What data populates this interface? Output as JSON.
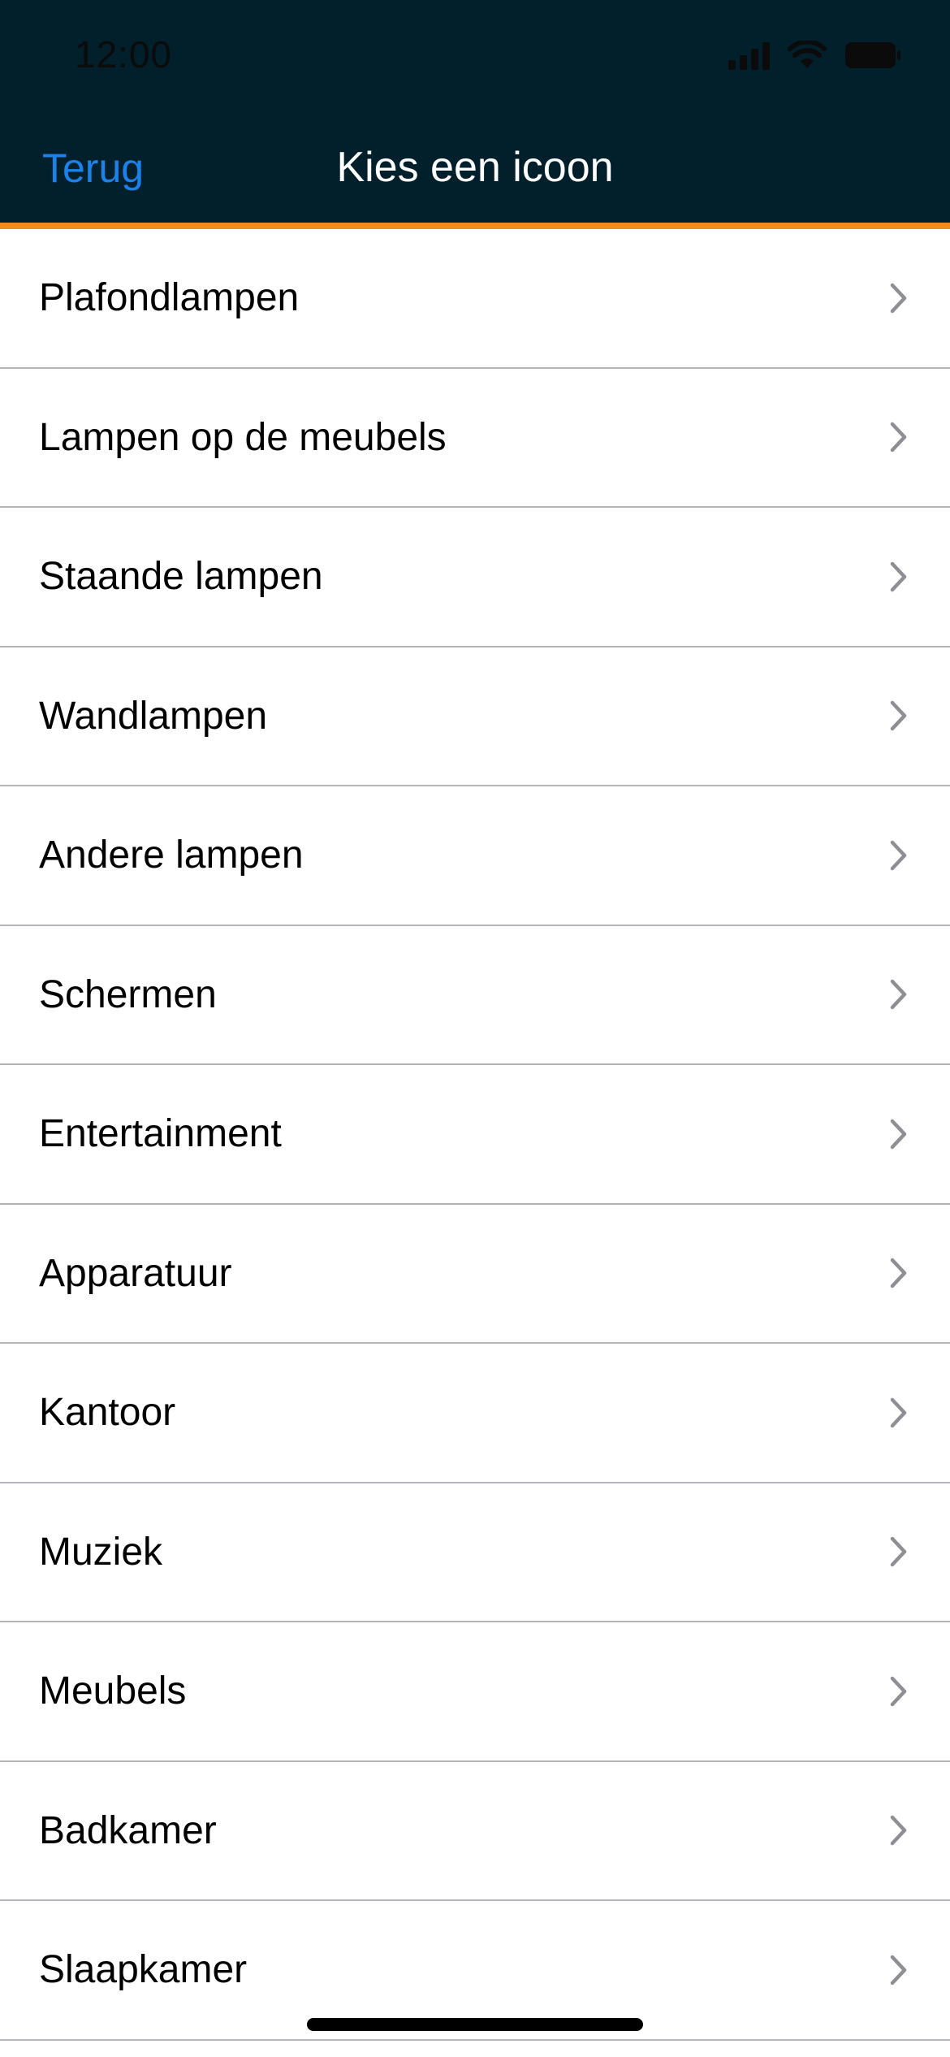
{
  "status_bar": {
    "time": "12:00",
    "icons": [
      "signal-icon",
      "wifi-icon",
      "battery-icon"
    ]
  },
  "nav": {
    "back_label": "Terug",
    "title": "Kies een icoon"
  },
  "colors": {
    "header_background": "#01202b",
    "accent_line": "#f28c1e",
    "back_link": "#1a82e8",
    "chevron": "#8e8e93",
    "separator": "#b4b4b8"
  },
  "list": {
    "items": [
      {
        "label": "Plafondlampen"
      },
      {
        "label": "Lampen op de meubels"
      },
      {
        "label": "Staande lampen"
      },
      {
        "label": "Wandlampen"
      },
      {
        "label": "Andere lampen"
      },
      {
        "label": "Schermen"
      },
      {
        "label": "Entertainment"
      },
      {
        "label": "Apparatuur"
      },
      {
        "label": "Kantoor"
      },
      {
        "label": "Muziek"
      },
      {
        "label": "Meubels"
      },
      {
        "label": "Badkamer"
      },
      {
        "label": "Slaapkamer"
      }
    ],
    "item_icon": "chevron-right-icon"
  }
}
